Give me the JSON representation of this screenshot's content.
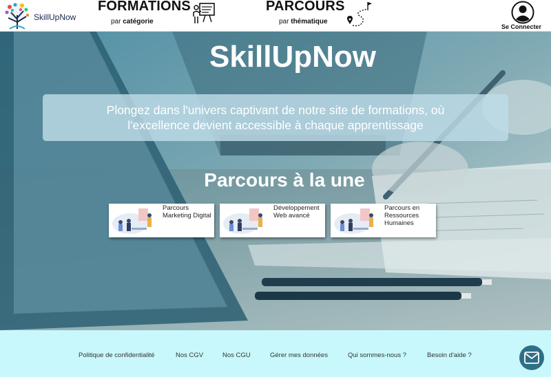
{
  "header": {
    "logo_text": "SkillUpNow",
    "nav": [
      {
        "title": "FORMATIONS",
        "sub_prefix": "par ",
        "sub_bold": "catégorie",
        "icon": "presentation-board-icon"
      },
      {
        "title": "PARCOURS",
        "sub_prefix": "par ",
        "sub_bold": "thématique",
        "icon": "route-path-icon"
      }
    ],
    "login_label": "Se Connecter",
    "login_icon": "user-avatar-icon"
  },
  "hero": {
    "title": "SkillUpNow",
    "tagline_line1": "Plongez dans l'univers captivant de notre site de formations, où",
    "tagline_line2": "l'excellence devient accessible à chaque apprentissage",
    "section_title": "Parcours à la une",
    "cards": [
      {
        "label": "Parcours Marketing Digital"
      },
      {
        "label": "Développement Web avancé"
      },
      {
        "label": "Parcours en Ressources Humaines"
      }
    ]
  },
  "footer": {
    "links": [
      "Politique de confidentialité",
      "Nos CGV",
      "Nos CGU",
      "Gérer mes données",
      "Qui sommes-nous ?",
      "Besoin d'aide ?"
    ],
    "chat_icon": "envelope-icon"
  },
  "colors": {
    "footer_bg": "#c8f8fb",
    "chat_bg": "#2f6f86",
    "logo_blue": "#1a2b4c"
  }
}
